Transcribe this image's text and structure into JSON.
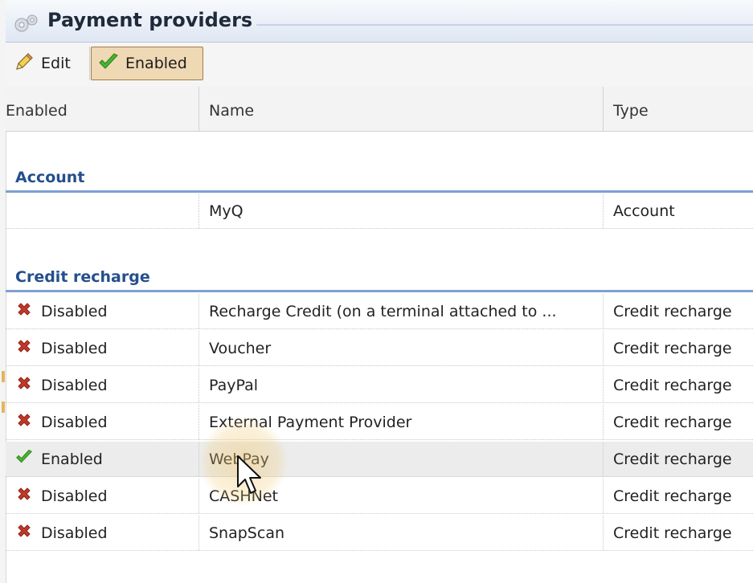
{
  "window": {
    "title": "Payment providers",
    "icon": "gear-icon"
  },
  "toolbar": {
    "edit_label": "Edit",
    "edit_icon": "pencil-icon",
    "enabled_label": "Enabled",
    "enabled_icon": "checkmark-icon",
    "enabled_active": true
  },
  "table": {
    "columns": [
      "Enabled",
      "Name",
      "Type"
    ],
    "groups": [
      {
        "label": "Account",
        "rows": [
          {
            "enabled": "",
            "status": "none",
            "name": "MyQ",
            "type": "Account"
          }
        ]
      },
      {
        "label": "Credit recharge",
        "rows": [
          {
            "enabled": "Disabled",
            "status": "disabled",
            "name": "Recharge Credit (on a terminal attached to ...",
            "type": "Credit recharge"
          },
          {
            "enabled": "Disabled",
            "status": "disabled",
            "name": "Voucher",
            "type": "Credit recharge"
          },
          {
            "enabled": "Disabled",
            "status": "disabled",
            "name": "PayPal",
            "type": "Credit recharge"
          },
          {
            "enabled": "Disabled",
            "status": "disabled",
            "name": "External Payment Provider",
            "type": "Credit recharge"
          },
          {
            "enabled": "Enabled",
            "status": "enabled",
            "name": "WebPay",
            "type": "Credit recharge",
            "selected": true
          },
          {
            "enabled": "Disabled",
            "status": "disabled",
            "name": "CASHNet",
            "type": "Credit recharge"
          },
          {
            "enabled": "Disabled",
            "status": "disabled",
            "name": "SnapScan",
            "type": "Credit recharge"
          }
        ]
      }
    ]
  },
  "colors": {
    "group_header_text": "#244f8c",
    "group_divider": "#7fa0d2",
    "disabled_icon": "#c0392b",
    "enabled_icon": "#3fae2a",
    "active_button_bg": "#efd9b4"
  }
}
